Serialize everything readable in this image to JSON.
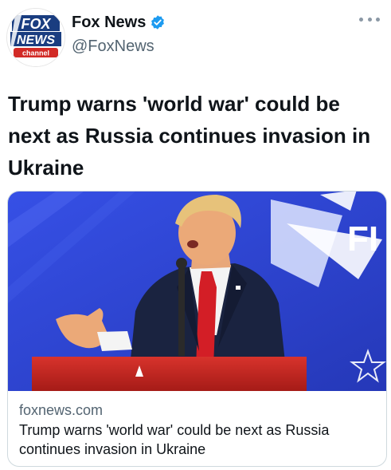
{
  "author": {
    "display_name": "Fox News",
    "handle": "@FoxNews",
    "verified": true,
    "avatar_logo_text": [
      "FOX",
      "NEWS",
      "channel"
    ],
    "avatar_icon": "fox-news-channel-logo"
  },
  "menu": {
    "icon": "more-horizontal-icon"
  },
  "tweet": {
    "text": "Trump warns 'world war' could be next as Russia continues invasion in Ukraine"
  },
  "card": {
    "image_icon": "news-photo",
    "image_sign_text": "FI",
    "domain": "foxnews.com",
    "title": "Trump warns 'world war' could be next as Russia continues invasion in Ukraine"
  },
  "colors": {
    "verified": "#1d9bf0",
    "secondary_text": "#536471",
    "primary_text": "#0f1419",
    "card_border": "#cfd9de",
    "photo_background": "#2f46d8",
    "podium_red": "#c8231f",
    "logo_blue": "#1a3d80",
    "logo_red": "#d22a26"
  }
}
